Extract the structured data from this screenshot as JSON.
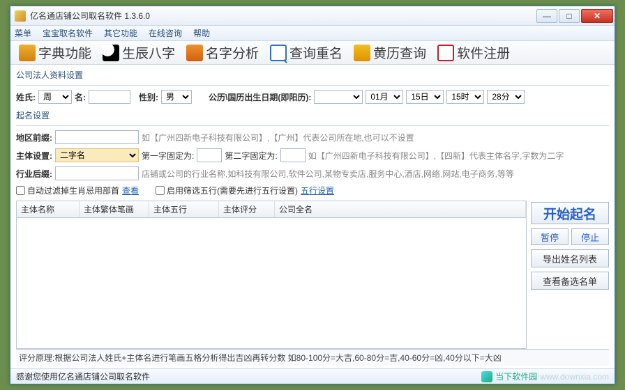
{
  "window": {
    "title": "亿名通店铺公司取名软件 1.3.6.0"
  },
  "menu": {
    "items": [
      "菜单",
      "宝宝取名软件",
      "其它功能",
      "在线咨询",
      "帮助"
    ]
  },
  "toolbar": {
    "dict": "字典功能",
    "bagua": "生辰八字",
    "name": "名字分析",
    "query": "查询重名",
    "calendar": "黄历查询",
    "register": "软件注册",
    "reg_glyph": "R"
  },
  "section1": {
    "title": "公司法人资料设置",
    "surname_lbl": "姓氏:",
    "surname_val": "周",
    "ming_lbl": "名:",
    "ming_val": "",
    "gender_lbl": "性别:",
    "gender_val": "男",
    "birth_lbl": "公历\\国历出生日期(即阳历):",
    "year_val": "",
    "month_val": "01月",
    "day_val": "15日",
    "hour_val": "15时",
    "min_val": "28分"
  },
  "section2": {
    "title": "起名设置",
    "region_lbl": "地区前缀:",
    "region_hint": "如【广州四新电子科技有限公司】,【广州】代表公司所在地,也可以不设置",
    "subject_lbl": "主体设置:",
    "subject_val": "二字名",
    "fix1_lbl": "第一字固定为:",
    "fix2_lbl": "第二字固定为:",
    "subject_hint": "如【广州四新电子科技有限公司】,【四新】代表主体名字,字数为二字",
    "industry_lbl": "行业后缀:",
    "industry_hint": "店铺或公司的行业名称,如科技有限公司,软件公司,某物专卖店,服务中心,酒店,网络,网站,电子商务,等等",
    "auto_filter": "自动过滤掉生肖忌用部首",
    "view": "查看",
    "enable_wuxing": "启用筛选五行(需要先进行五行设置)",
    "wuxing_link": "五行设置"
  },
  "table": {
    "cols": [
      "主体名称",
      "主体繁体笔画",
      "主体五行",
      "主体评分",
      "公司全名"
    ]
  },
  "panel": {
    "start": "开始起名",
    "pause": "暂停",
    "stop": "停止",
    "export": "导出姓名列表",
    "view_alt": "查看备选名单"
  },
  "footer": "评分原理:根据公司法人姓氏+主体名进行笔画五格分析得出吉凶再转分数 如80-100分=大吉,60-80分=吉,40-60分=凶,40分以下=大凶",
  "status": {
    "msg": "感谢您使用亿名通店铺公司取名软件",
    "brand": "当下软件园",
    "url": "www.downxia.com"
  }
}
